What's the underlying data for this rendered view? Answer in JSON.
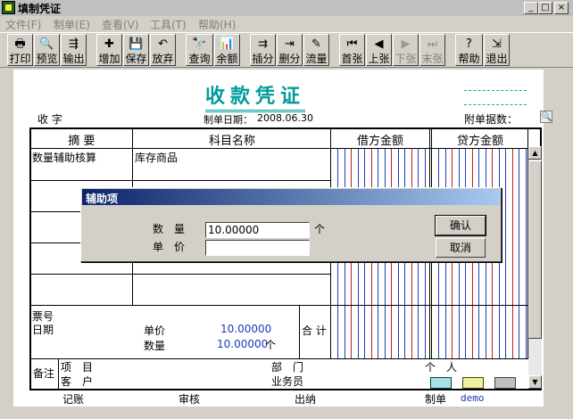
{
  "window": {
    "title": "填制凭证",
    "min": "_",
    "max": "□",
    "close": "×"
  },
  "menu": [
    "文件(F)",
    "制单(E)",
    "查看(V)",
    "工具(T)",
    "帮助(H)"
  ],
  "toolbar": [
    {
      "label": "打印",
      "icon": "🖶",
      "enabled": true
    },
    {
      "label": "预览",
      "icon": "🔍",
      "enabled": true
    },
    {
      "label": "输出",
      "icon": "⇶",
      "enabled": true
    },
    {
      "label": "增加",
      "icon": "✚",
      "enabled": true
    },
    {
      "label": "保存",
      "icon": "💾",
      "enabled": true
    },
    {
      "label": "放弃",
      "icon": "↶",
      "enabled": true
    },
    {
      "label": "查询",
      "icon": "🔭",
      "enabled": true
    },
    {
      "label": "余额",
      "icon": "📊",
      "enabled": true
    },
    {
      "label": "插分",
      "icon": "⇉",
      "enabled": true
    },
    {
      "label": "删分",
      "icon": "⇥",
      "enabled": true
    },
    {
      "label": "流量",
      "icon": "✎",
      "enabled": true
    },
    {
      "label": "首张",
      "icon": "⏮",
      "enabled": true
    },
    {
      "label": "上张",
      "icon": "◀",
      "enabled": true
    },
    {
      "label": "下张",
      "icon": "▶",
      "enabled": false
    },
    {
      "label": "末张",
      "icon": "⏭",
      "enabled": false
    },
    {
      "label": "帮助",
      "icon": "?",
      "enabled": true
    },
    {
      "label": "退出",
      "icon": "⇲",
      "enabled": true
    }
  ],
  "voucher": {
    "title": "收款凭证",
    "type_label": "收 字",
    "date_label": "制单日期：",
    "date": "2008.06.30",
    "attachments_label": "附单据数："
  },
  "table": {
    "headers": [
      "摘 要",
      "科目名称",
      "借方金额",
      "贷方金额"
    ],
    "rows": [
      {
        "summary": "数量辅助核算",
        "account": "库存商品"
      }
    ],
    "footer": {
      "ticket_label": "票号",
      "date_label": "日期",
      "unit_price_label": "单价",
      "unit_price": "10.00000",
      "quantity_label": "数量",
      "quantity": "10.00000",
      "quantity_unit": "个",
      "total_label": "合 计"
    }
  },
  "remarks": {
    "label": "备注",
    "project_label": "项　目",
    "department_label": "部　门",
    "person_label": "个　人",
    "customer_label": "客　户",
    "salesperson_label": "业务员"
  },
  "signatures": {
    "posted_label": "记账",
    "reviewed_label": "审核",
    "cashier_label": "出纳",
    "maker_label": "制单",
    "maker": "demo"
  },
  "dialog": {
    "title": "辅助项",
    "quantity_label": "数　量",
    "quantity_value": "10.00000",
    "quantity_unit": "个",
    "unit_price_label": "单　价",
    "unit_price_value": "",
    "ok_label": "确认",
    "cancel_label": "取消"
  }
}
